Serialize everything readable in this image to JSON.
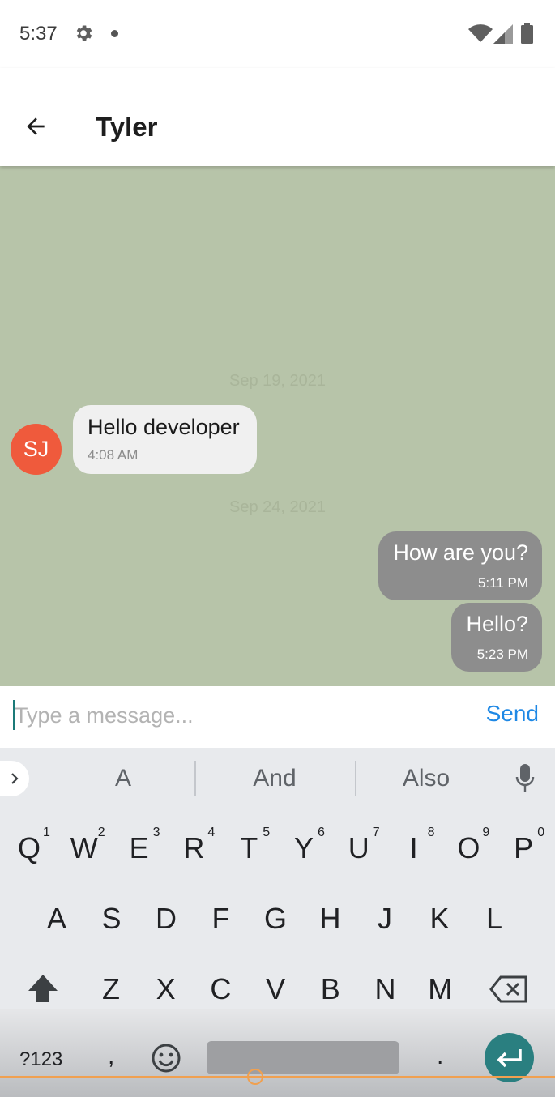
{
  "status_bar": {
    "time": "5:37",
    "icons": [
      "gear-icon",
      "notification-dot-icon",
      "wifi-icon",
      "signal-icon",
      "battery-icon"
    ]
  },
  "app_bar": {
    "title": "Tyler",
    "back_icon": "arrow-left-icon"
  },
  "chat": {
    "background_color": "#b7c4a9",
    "sections": [
      {
        "date": "Sep 19, 2021",
        "messages": [
          {
            "direction": "incoming",
            "avatar_initials": "SJ",
            "avatar_color": "#ef5a3c",
            "text": "Hello developer",
            "time": "4:08 AM"
          }
        ]
      },
      {
        "date": "Sep 24, 2021",
        "messages": [
          {
            "direction": "outgoing",
            "text": "How are you?",
            "time": "5:11 PM"
          },
          {
            "direction": "outgoing",
            "text": "Hello?",
            "time": "5:23 PM"
          }
        ]
      }
    ]
  },
  "composer": {
    "placeholder": "Type a message...",
    "send_label": "Send",
    "send_color": "#1e88e5"
  },
  "keyboard": {
    "suggestions": [
      "A",
      "And",
      "Also"
    ],
    "row1": [
      "Q",
      "W",
      "E",
      "R",
      "T",
      "Y",
      "U",
      "I",
      "O",
      "P"
    ],
    "row1_hints": [
      "1",
      "2",
      "3",
      "4",
      "5",
      "6",
      "7",
      "8",
      "9",
      "0"
    ],
    "row2": [
      "A",
      "S",
      "D",
      "F",
      "G",
      "H",
      "J",
      "K",
      "L"
    ],
    "row3": [
      "Z",
      "X",
      "C",
      "V",
      "B",
      "N",
      "M"
    ],
    "symbols_label": "?123",
    "comma_label": ",",
    "period_label": ".",
    "accent_color": "#2a7f80"
  }
}
